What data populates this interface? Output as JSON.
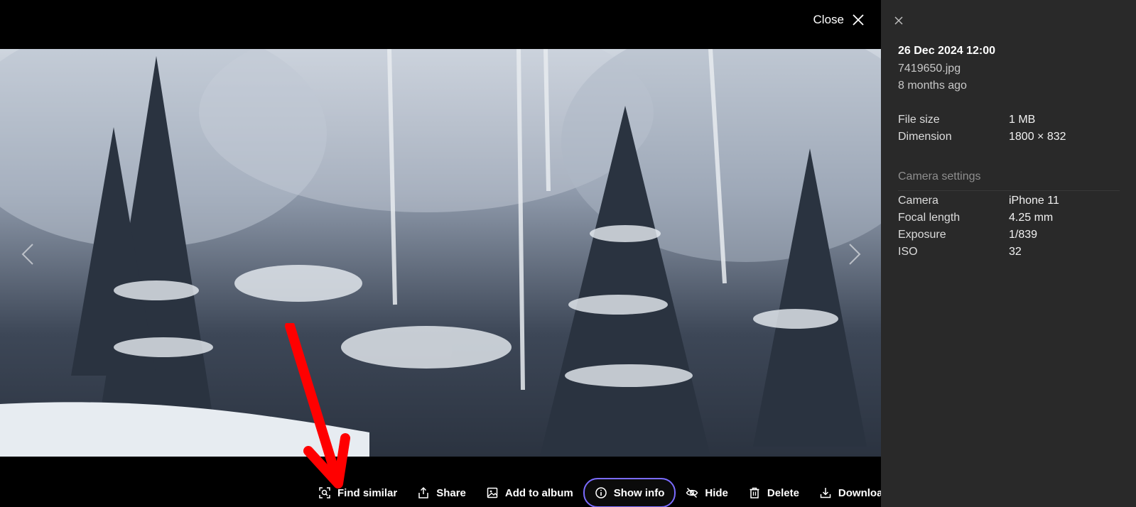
{
  "viewer": {
    "close_label": "Close"
  },
  "toolbar": {
    "find_similar": "Find similar",
    "share": "Share",
    "add_to_album": "Add to album",
    "show_info": "Show info",
    "hide": "Hide",
    "delete": "Delete",
    "download": "Download"
  },
  "info": {
    "date": "26 Dec 2024 12:00",
    "filename": "7419650.jpg",
    "relative_time": "8 months ago",
    "file_size_label": "File size",
    "file_size": "1 MB",
    "dimension_label": "Dimension",
    "dimension": "1800 × 832",
    "camera_section": "Camera settings",
    "camera_label": "Camera",
    "camera": "iPhone 11",
    "focal_label": "Focal length",
    "focal": "4.25 mm",
    "exposure_label": "Exposure",
    "exposure": "1/839",
    "iso_label": "ISO",
    "iso": "32"
  },
  "colors": {
    "panel_bg": "#292929",
    "active_outline": "#7a6bff",
    "annotation": "#ff0000"
  }
}
